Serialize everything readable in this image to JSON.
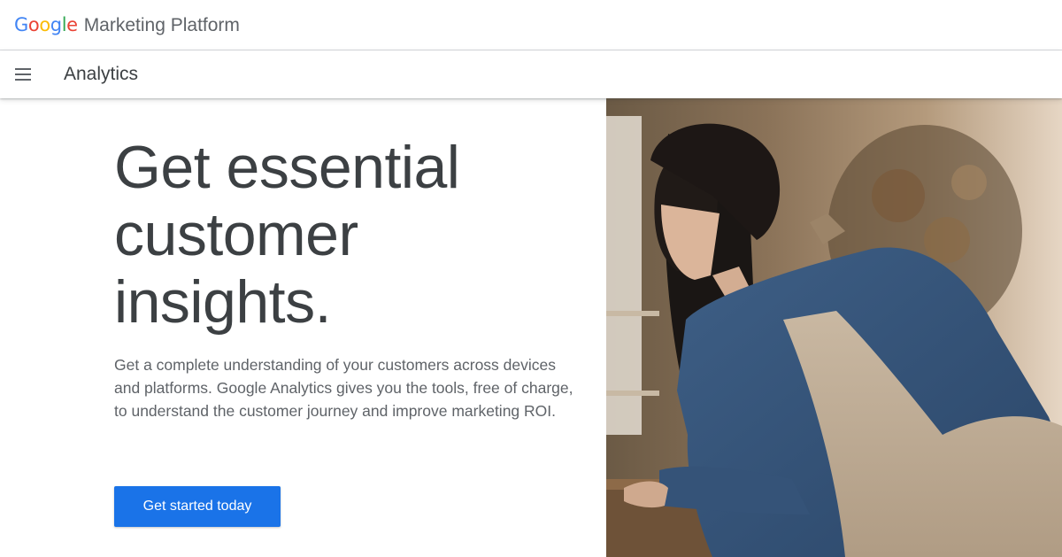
{
  "header": {
    "logo_text": "Google",
    "logo_letters": [
      {
        "char": "G",
        "color": "#4285F4"
      },
      {
        "char": "o",
        "color": "#EA4335"
      },
      {
        "char": "o",
        "color": "#FBBC05"
      },
      {
        "char": "g",
        "color": "#4285F4"
      },
      {
        "char": "l",
        "color": "#34A853"
      },
      {
        "char": "e",
        "color": "#EA4335"
      }
    ],
    "product_name": "Marketing Platform"
  },
  "subnav": {
    "menu_icon": "hamburger-menu-icon",
    "title": "Analytics"
  },
  "hero": {
    "headline_line1": "Get essential",
    "headline_line2": "customer",
    "headline_line3": "insights.",
    "description": "Get a complete understanding of your customers across devices and platforms. Google Analytics gives you the tools, free of charge, to understand the customer journey and improve marketing ROI.",
    "cta_label": "Get started today",
    "cta_color": "#1A73E8"
  },
  "colors": {
    "text_primary": "#3C4043",
    "text_secondary": "#5F6368",
    "divider": "#DADCE0"
  }
}
